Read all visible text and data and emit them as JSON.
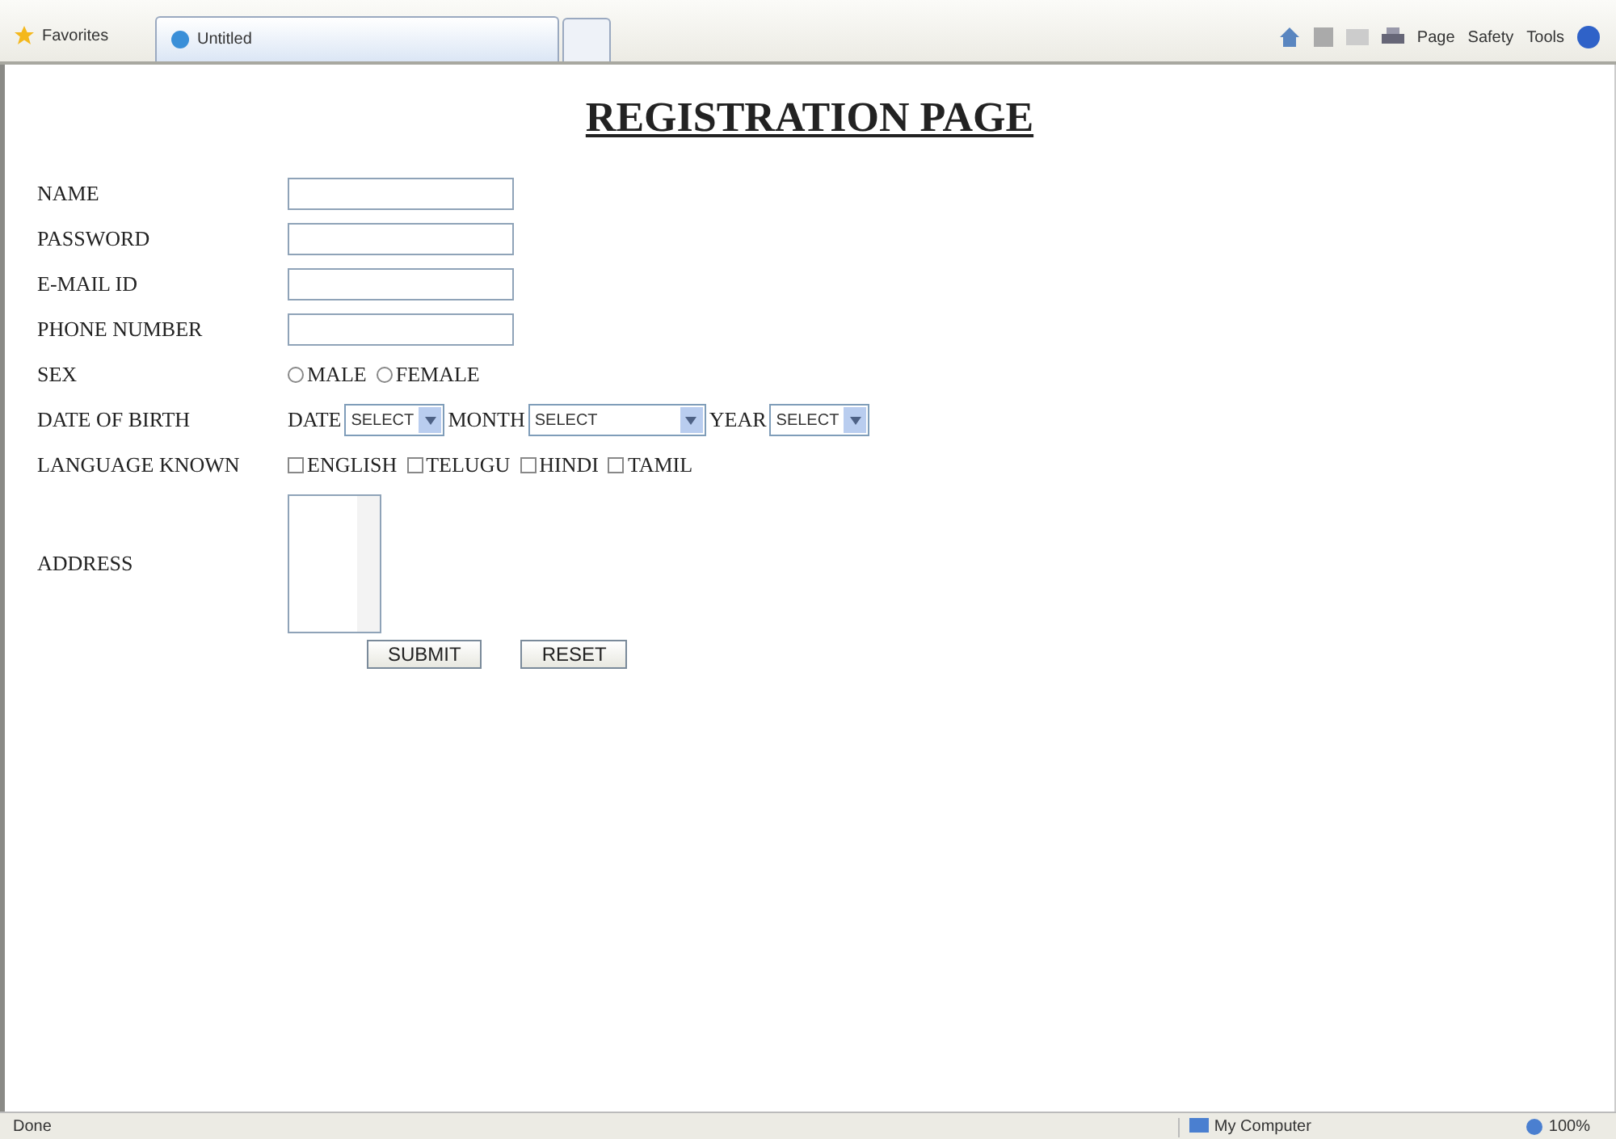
{
  "browser": {
    "favorites": "Favorites",
    "tab_title": "Untitled",
    "commands": [
      "Page",
      "Safety",
      "Tools"
    ]
  },
  "page": {
    "title": "REGISTRATION PAGE",
    "fields": [
      {
        "label": "NAME",
        "kind": "text"
      },
      {
        "label": "PASSWORD",
        "kind": "text"
      },
      {
        "label": "E-MAIL ID",
        "kind": "text"
      },
      {
        "label": "PHONE NUMBER",
        "kind": "text"
      },
      {
        "label": "SEX",
        "kind": "radio",
        "options": [
          {
            "label": "MALE",
            "selected": false
          },
          {
            "label": "FEMALE",
            "selected": false
          }
        ]
      },
      {
        "label": "DATE OF BIRTH",
        "kind": "selects",
        "selects": [
          {
            "label": "DATE",
            "value": "SELECT"
          },
          {
            "label": "MONTH",
            "value": "SELECT"
          },
          {
            "label": "YEAR",
            "value": "SELECT"
          }
        ]
      },
      {
        "label": "LANGUAGE KNOWN",
        "kind": "checks",
        "options": [
          {
            "label": "ENGLISH",
            "checked": false
          },
          {
            "label": "TELUGU",
            "checked": false
          },
          {
            "label": "HINDI",
            "checked": false
          },
          {
            "label": "TAMIL",
            "checked": false
          }
        ]
      },
      {
        "label": "ADDRESS",
        "kind": "textarea"
      }
    ],
    "buttons": [
      "SUBMIT",
      "RESET"
    ]
  },
  "status_bar": {
    "status": "Done",
    "zone": "My Computer",
    "zoom": "100%"
  }
}
